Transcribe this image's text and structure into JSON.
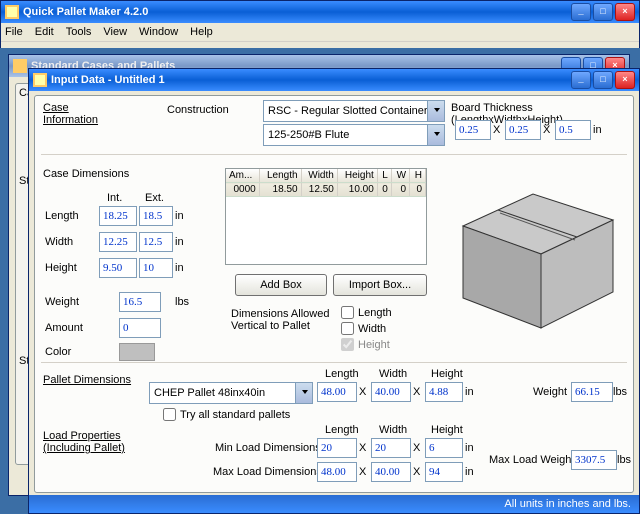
{
  "appTitle": "Quick Pallet Maker 4.2.0",
  "menus": [
    "File",
    "Edit",
    "Tools",
    "View",
    "Window",
    "Help"
  ],
  "bgWinTitle": "Standard Cases and Pallets",
  "inputWinTitle": "Input Data - Untitled 1",
  "caseInfo": {
    "heading": "Case\nInformation"
  },
  "construction": {
    "lbl": "Construction",
    "opt1": "RSC - Regular Slotted Container",
    "opt2": "125-250#B Flute"
  },
  "board": {
    "lbl": "Board Thickness (LengthxWidthxHeight)",
    "l": "0.25",
    "w": "0.25",
    "h": "0.5",
    "x": "X",
    "unit": "in"
  },
  "caseDims": {
    "heading": "Case Dimensions",
    "intHdr": "Int.",
    "extHdr": "Ext.",
    "rows": {
      "Length": {
        "int": "18.25",
        "ext": "18.5"
      },
      "Width": {
        "int": "12.25",
        "ext": "12.5"
      },
      "Height": {
        "int": "9.50",
        "ext": "10"
      }
    },
    "weightLbl": "Weight",
    "weight": "16.5",
    "weightUnit": "lbs",
    "amountLbl": "Amount",
    "amount": "0",
    "colorLbl": "Color"
  },
  "table": {
    "hdr": [
      "Am...",
      "Length",
      "Width",
      "Height",
      "L",
      "W",
      "H"
    ],
    "row": [
      "0000",
      "18.50",
      "12.50",
      "10.00",
      "0",
      "0",
      "0"
    ]
  },
  "btns": {
    "add": "Add Box",
    "import": "Import Box..."
  },
  "vert": {
    "lbl": "Dimensions Allowed\nVertical to Pallet",
    "len": "Length",
    "wid": "Width",
    "hgt": "Height"
  },
  "palletDims": {
    "heading": "Pallet Dimensions",
    "sel": "CHEP Pallet 48inx40in",
    "lenLbl": "Length",
    "widLbl": "Width",
    "hgtLbl": "Height",
    "l": "48.00",
    "w": "40.00",
    "h": "4.88",
    "x": "X",
    "unit": "in",
    "try": "Try all standard pallets",
    "weightLbl": "Weight",
    "weight": "66.15",
    "weightUnit": "lbs"
  },
  "loadProps": {
    "heading": "Load Properties\n(Including Pallet)",
    "lenLbl": "Length",
    "widLbl": "Width",
    "hgtLbl": "Height",
    "minLbl": "Min Load Dimensions",
    "min": {
      "l": "20",
      "w": "20",
      "h": "6"
    },
    "maxLbl": "Max Load Dimensions",
    "max": {
      "l": "48.00",
      "w": "40.00",
      "h": "94"
    },
    "x": "X",
    "unit": "in",
    "maxWLbl": "Max Load Weight",
    "maxW": "3307.5",
    "maxWU": "lbs"
  },
  "status": "All units in inches and lbs."
}
